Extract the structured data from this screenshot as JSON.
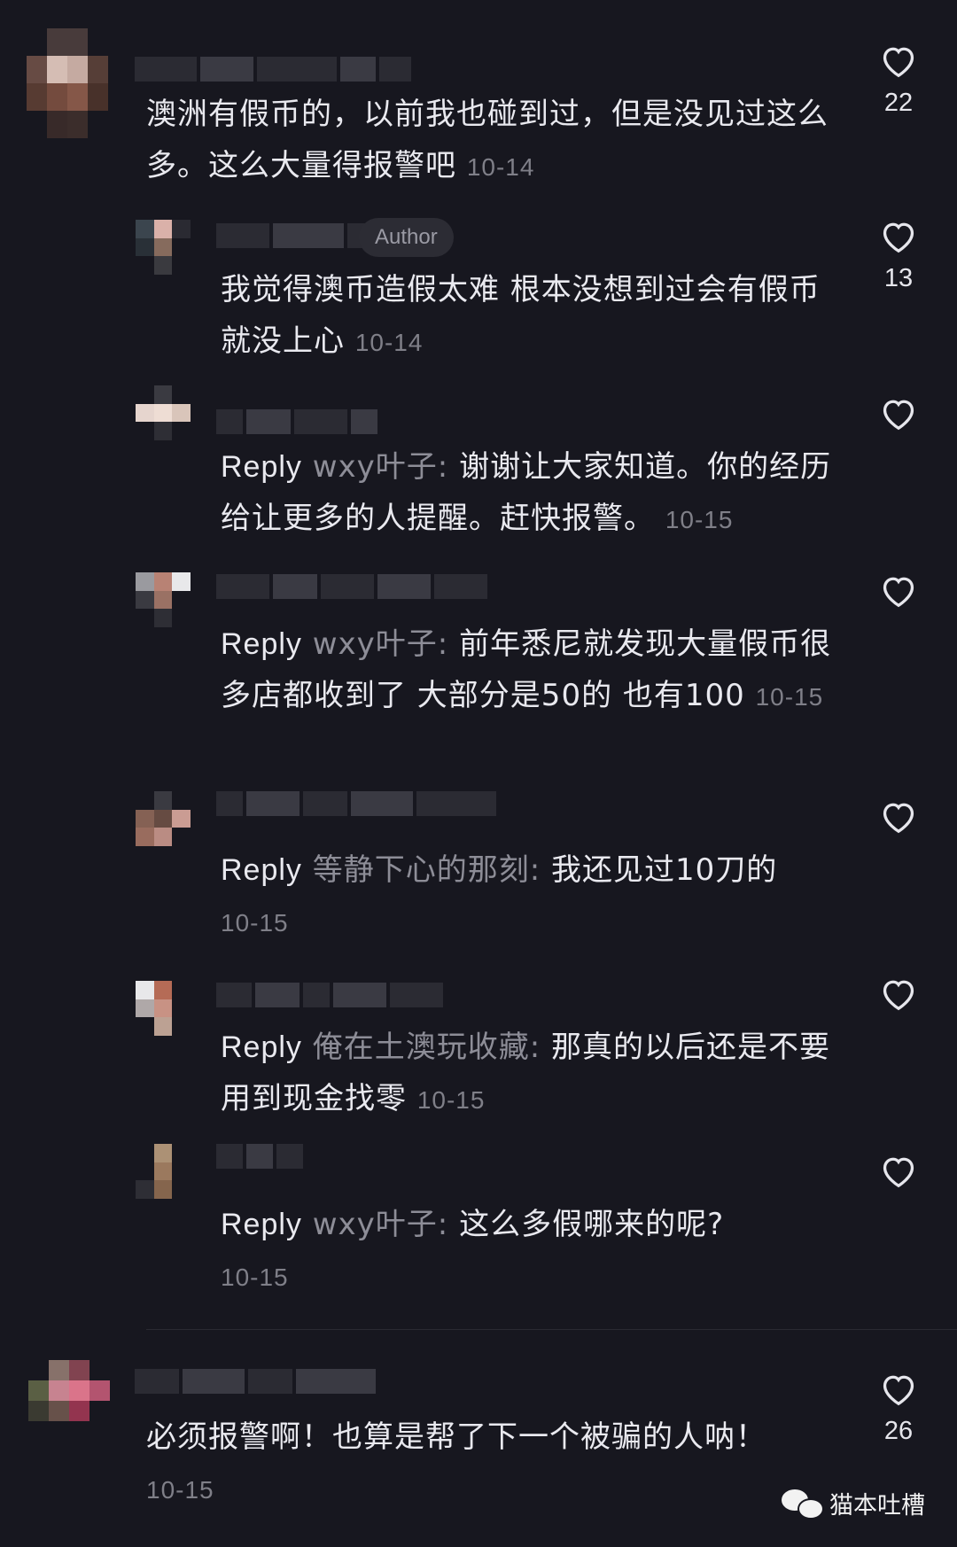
{
  "comments": [
    {
      "text": "澳洲有假币的，以前我也碰到过，但是没见过这么多。这么大量得报警吧",
      "time": "10-14",
      "likes": "22"
    },
    {
      "badge": "Author",
      "text": "我觉得澳币造假太难 根本没想到过会有假币 就没上心",
      "time": "10-14",
      "likes": "13"
    },
    {
      "reply_label": "Reply",
      "target": "wxy叶子:",
      "text": "谢谢让大家知道。你的经历给让更多的人提醒。赶快报警。",
      "time": "10-15"
    },
    {
      "reply_label": "Reply",
      "target": "wxy叶子:",
      "text": "前年悉尼就发现大量假币很多店都收到了 大部分是50的 也有100",
      "time": "10-15"
    },
    {
      "reply_label": "Reply",
      "target": "等静下心的那刻:",
      "text": "我还见过10刀的",
      "time": "10-15"
    },
    {
      "reply_label": "Reply",
      "target": "俺在土澳玩收藏:",
      "text": "那真的以后还是不要用到现金找零",
      "time": "10-15"
    },
    {
      "reply_label": "Reply",
      "target": "wxy叶子:",
      "text": "这么多假哪来的呢?",
      "time": "10-15"
    },
    {
      "text": "必须报警啊！也算是帮了下一个被骗的人呐！",
      "time": "10-15",
      "likes": "26"
    }
  ],
  "watermark": {
    "text": "猫本吐槽"
  },
  "icons": {
    "like": "heart-outline-icon",
    "watermark": "wechat-icon"
  },
  "colors": {
    "background": "#17171f",
    "text": "#e9e9ef",
    "muted": "#8d8d97"
  }
}
